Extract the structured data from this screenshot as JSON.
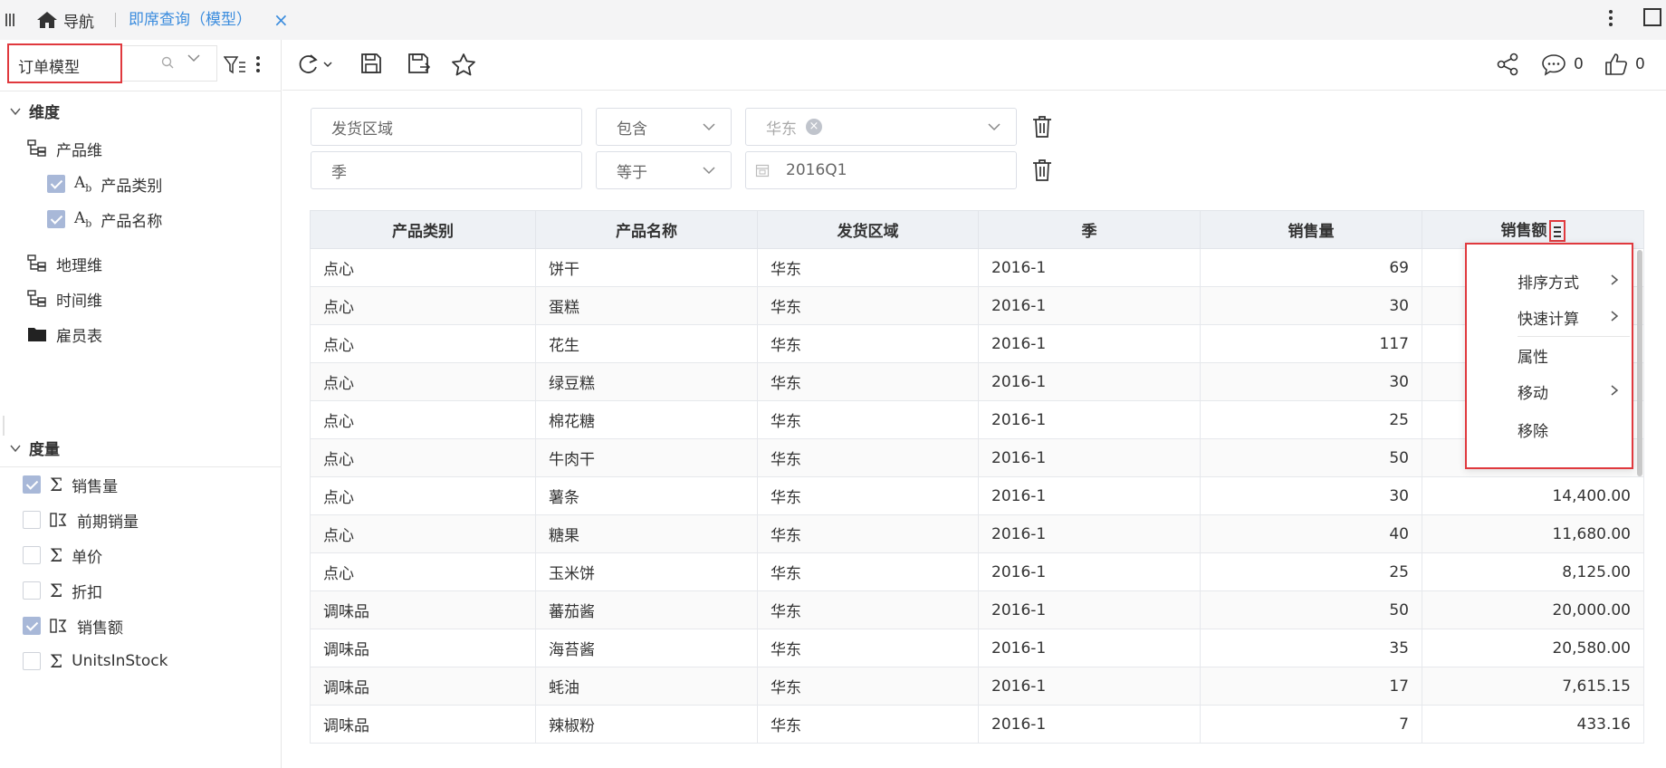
{
  "topbar": {
    "home_label": "导航",
    "active_tab": "即席查询（模型）",
    "close_symbol": "×"
  },
  "left": {
    "model_value": "订单模型",
    "dimension_title": "维度",
    "dimensions": [
      {
        "label": "产品维",
        "type": "hierarchy"
      },
      {
        "label": "产品类别",
        "type": "field",
        "checked": true
      },
      {
        "label": "产品名称",
        "type": "field",
        "checked": true
      },
      {
        "label": "地理维",
        "type": "hierarchy"
      },
      {
        "label": "时间维",
        "type": "hierarchy"
      },
      {
        "label": "雇员表",
        "type": "folder"
      }
    ],
    "measure_title": "度量",
    "measures": [
      {
        "label": "销售量",
        "checked": true,
        "icon": "sigma"
      },
      {
        "label": "前期销量",
        "checked": false,
        "icon": "calc-measure"
      },
      {
        "label": "单价",
        "checked": false,
        "icon": "sigma"
      },
      {
        "label": "折扣",
        "checked": false,
        "icon": "sigma"
      },
      {
        "label": "销售额",
        "checked": true,
        "icon": "calc-measure"
      },
      {
        "label": "UnitsInStock",
        "checked": false,
        "icon": "sigma"
      }
    ]
  },
  "toolbar": {
    "comment_count": "0",
    "like_count": "0"
  },
  "filters": [
    {
      "field": "发货区域",
      "operator": "包含",
      "value": "华东"
    },
    {
      "field": "季",
      "operator": "等于",
      "value": "2016Q1"
    }
  ],
  "table": {
    "columns": [
      "产品类别",
      "产品名称",
      "发货区域",
      "季",
      "销售量",
      "销售额"
    ],
    "rows": [
      [
        "点心",
        "饼干",
        "华东",
        "2016-1",
        "69",
        ""
      ],
      [
        "点心",
        "蛋糕",
        "华东",
        "2016-1",
        "30",
        ""
      ],
      [
        "点心",
        "花生",
        "华东",
        "2016-1",
        "117",
        ""
      ],
      [
        "点心",
        "绿豆糕",
        "华东",
        "2016-1",
        "30",
        ""
      ],
      [
        "点心",
        "棉花糖",
        "华东",
        "2016-1",
        "25",
        ""
      ],
      [
        "点心",
        "牛肉干",
        "华东",
        "2016-1",
        "50",
        ""
      ],
      [
        "点心",
        "薯条",
        "华东",
        "2016-1",
        "30",
        "14,400.00"
      ],
      [
        "点心",
        "糖果",
        "华东",
        "2016-1",
        "40",
        "11,680.00"
      ],
      [
        "点心",
        "玉米饼",
        "华东",
        "2016-1",
        "25",
        "8,125.00"
      ],
      [
        "调味品",
        "蕃茄酱",
        "华东",
        "2016-1",
        "50",
        "20,000.00"
      ],
      [
        "调味品",
        "海苔酱",
        "华东",
        "2016-1",
        "35",
        "20,580.00"
      ],
      [
        "调味品",
        "蚝油",
        "华东",
        "2016-1",
        "17",
        "7,615.15"
      ],
      [
        "调味品",
        "辣椒粉",
        "华东",
        "2016-1",
        "7",
        "433.16"
      ]
    ]
  },
  "context_menu": {
    "items": [
      {
        "label": "排序方式",
        "submenu": true
      },
      {
        "label": "快速计算",
        "submenu": true
      },
      {
        "label": "属性",
        "submenu": false
      },
      {
        "label": "移动",
        "submenu": true
      },
      {
        "label": "移除",
        "submenu": false
      }
    ]
  },
  "colors": {
    "accent": "#3c8dde",
    "highlight_border": "#e0393e",
    "checkbox_checked": "#a8b8d8"
  }
}
